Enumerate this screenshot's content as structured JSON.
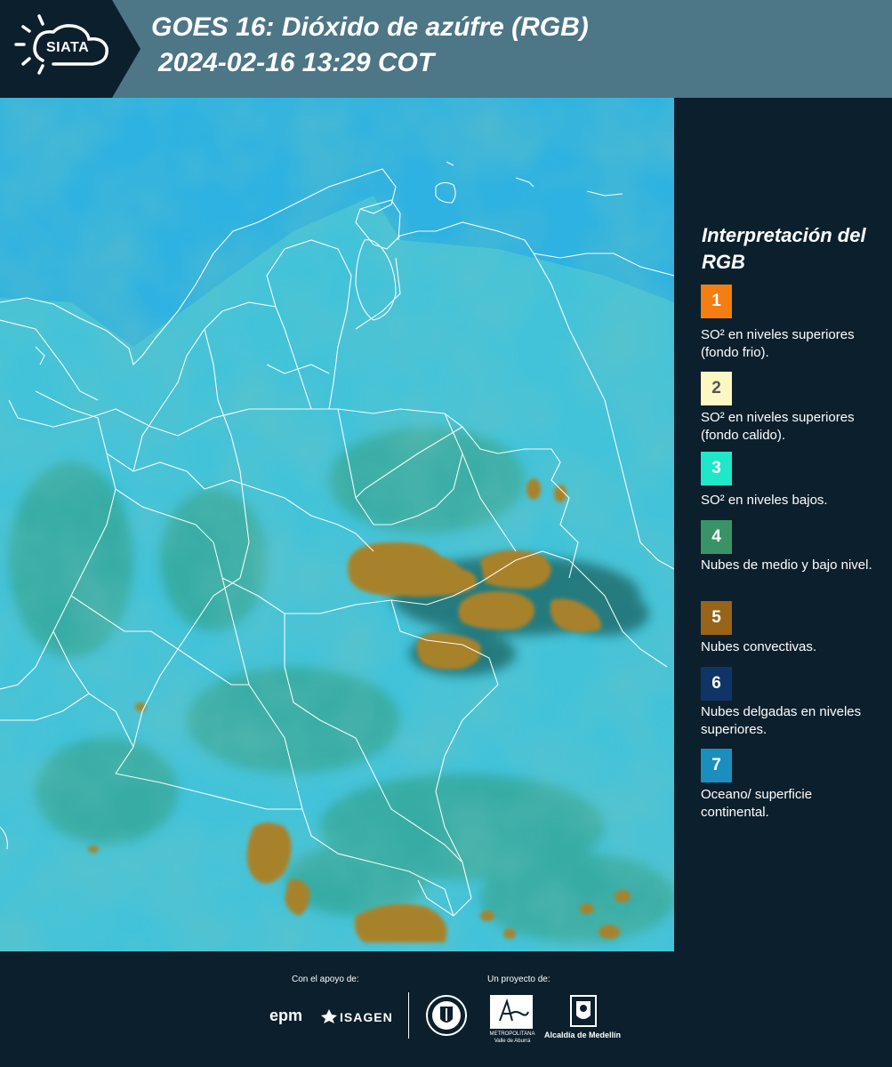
{
  "header": {
    "logo_text": "SIATA",
    "title_line1": "GOES 16: Dióxido de azúfre (RGB)",
    "title_line2": "2024-02-16 13:29 COT"
  },
  "legend": {
    "title": "Interpretación del RGB",
    "items": [
      {
        "number": "1",
        "color": "#f57e12",
        "text_color": "#ffffff",
        "label": "SO² en niveles superiores (fondo frio)."
      },
      {
        "number": "2",
        "color": "#fdf7c3",
        "text_color": "#555555",
        "label": "SO² en niveles superiores (fondo calido)."
      },
      {
        "number": "3",
        "color": "#1ee8c7",
        "text_color": "#ffffff",
        "label": "SO² en niveles bajos."
      },
      {
        "number": "4",
        "color": "#3a9366",
        "text_color": "#ffffff",
        "label": "Nubes de medio y bajo nivel."
      },
      {
        "number": "5",
        "color": "#986419",
        "text_color": "#ffffff",
        "label": "Nubes convectivas."
      },
      {
        "number": "6",
        "color": "#0f3566",
        "text_color": "#ffffff",
        "label": "Nubes delgadas en niveles superiores."
      },
      {
        "number": "7",
        "color": "#1a8fbf",
        "text_color": "#ffffff",
        "label": "Oceano/ superficie continental."
      }
    ]
  },
  "footer": {
    "support_label": "Con el apoyo de:",
    "project_label": "Un proyecto de:",
    "epm": "epm",
    "isagen": "ISAGEN",
    "area_metro": "METROPOLITANA",
    "area_sub": "Valle de Aburrá",
    "alcaldia": "Alcaldía de Medellín"
  },
  "colors": {
    "header_bg": "#4d7686",
    "dark_bg": "#0c1f2c",
    "ocean": "#2fb2e0",
    "land": "#42c4da",
    "convective": "#a8822c"
  }
}
